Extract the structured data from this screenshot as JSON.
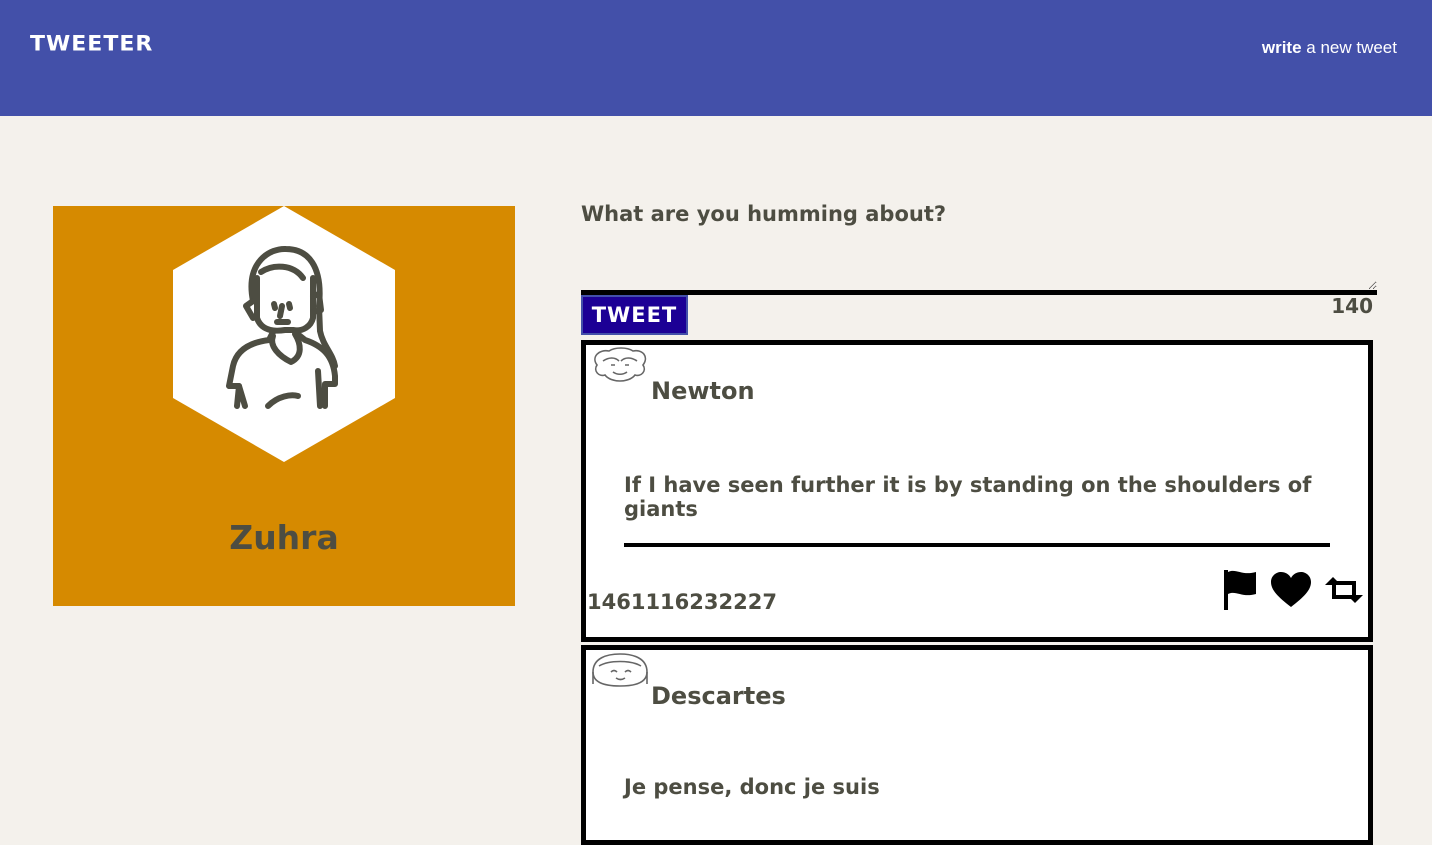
{
  "nav": {
    "brand": "TWEETER",
    "compose_bold": "write",
    "compose_rest": " a new tweet"
  },
  "profile": {
    "name": "Zuhra",
    "background_color": "#d68a00"
  },
  "composer": {
    "prompt": "What are you humming about?",
    "placeholder": "",
    "button_label": "TWEET",
    "counter": "140"
  },
  "tweets": [
    {
      "author": "Newton",
      "content": "If I have seen further it is by standing on the shoulders of giants",
      "timestamp": "1461116232227",
      "icons": [
        "flag-icon",
        "heart-icon",
        "retweet-icon"
      ]
    },
    {
      "author": "Descartes",
      "content": "Je pense, donc je suis",
      "timestamp": ""
    }
  ],
  "colors": {
    "nav": "#4350a9",
    "background": "#f4f1ec",
    "button": "#1c0095",
    "text": "#4d4d42"
  }
}
